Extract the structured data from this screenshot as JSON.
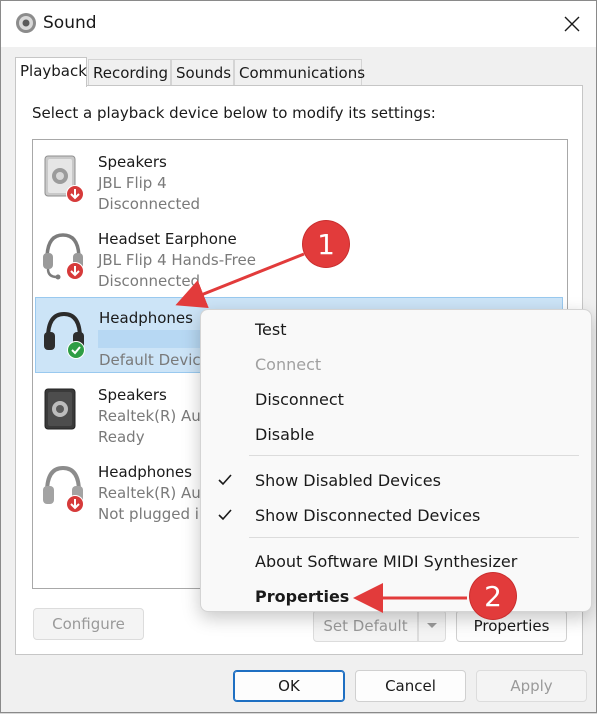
{
  "window": {
    "title": "Sound"
  },
  "tabs": [
    {
      "label": "Playback",
      "active": true
    },
    {
      "label": "Recording",
      "active": false
    },
    {
      "label": "Sounds",
      "active": false
    },
    {
      "label": "Communications",
      "active": false
    }
  ],
  "instruction": "Select a playback device below to modify its settings:",
  "devices": [
    {
      "name": "Speakers",
      "sub": "JBL Flip 4",
      "status": "Disconnected",
      "icon": "speaker-icon",
      "badge": "disconnected-badge"
    },
    {
      "name": "Headset Earphone",
      "sub": "JBL Flip 4 Hands-Free",
      "status": "Disconnected",
      "icon": "headset-icon",
      "badge": "disconnected-badge"
    },
    {
      "name": "Headphones",
      "sub": "",
      "status": "Default Device",
      "icon": "headphones-icon",
      "badge": "default-check-badge",
      "selected": true
    },
    {
      "name": "Speakers",
      "sub": "Realtek(R) Aud",
      "status": "Ready",
      "icon": "speaker-icon"
    },
    {
      "name": "Headphones",
      "sub": "Realtek(R) Aud",
      "status": "Not plugged in",
      "icon": "headphones-icon",
      "badge": "disconnected-badge"
    }
  ],
  "context_menu": {
    "items": [
      {
        "label": "Test",
        "enabled": true
      },
      {
        "label": "Connect",
        "enabled": false
      },
      {
        "label": "Disconnect",
        "enabled": true
      },
      {
        "label": "Disable",
        "enabled": true
      },
      {
        "label": "Show Disabled Devices",
        "checked": true
      },
      {
        "label": "Show Disconnected Devices",
        "checked": true
      },
      {
        "label": "About Software MIDI Synthesizer",
        "enabled": true
      },
      {
        "label": "Properties",
        "bold": true
      }
    ]
  },
  "buttons": {
    "configure": "Configure",
    "set_default": "Set Default",
    "properties": "Properties",
    "ok": "OK",
    "cancel": "Cancel",
    "apply": "Apply"
  },
  "callouts": [
    "1",
    "2"
  ],
  "colors": {
    "callout": "#e23b3b",
    "selection": "#cce4f7",
    "accent": "#1e6fc2"
  }
}
